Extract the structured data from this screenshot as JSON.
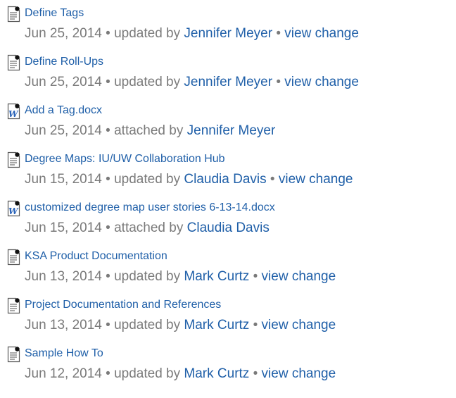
{
  "items": [
    {
      "type": "page",
      "icon": "page-icon",
      "title": "Define Tags",
      "date": "Jun 25, 2014",
      "action": "updated by",
      "user": "Jennifer Meyer",
      "change": "view change"
    },
    {
      "type": "page",
      "icon": "page-icon",
      "title": "Define Roll-Ups",
      "date": "Jun 25, 2014",
      "action": "updated by",
      "user": "Jennifer Meyer",
      "change": "view change"
    },
    {
      "type": "attachment",
      "icon": "word-doc-icon",
      "title": "Add a Tag.docx",
      "date": "Jun 25, 2014",
      "action": "attached by",
      "user": "Jennifer Meyer",
      "change": null
    },
    {
      "type": "page",
      "icon": "page-icon",
      "title": "Degree Maps: IU/UW Collaboration Hub",
      "date": "Jun 15, 2014",
      "action": "updated by",
      "user": "Claudia Davis",
      "change": "view change"
    },
    {
      "type": "attachment",
      "icon": "word-doc-icon",
      "title": "customized degree map user stories 6-13-14.docx",
      "date": "Jun 15, 2014",
      "action": "attached by",
      "user": "Claudia Davis",
      "change": null
    },
    {
      "type": "page",
      "icon": "page-icon",
      "title": "KSA Product Documentation",
      "date": "Jun 13, 2014",
      "action": "updated by",
      "user": "Mark Curtz",
      "change": "view change"
    },
    {
      "type": "page",
      "icon": "page-icon",
      "title": "Project Documentation and References",
      "date": "Jun 13, 2014",
      "action": "updated by",
      "user": "Mark Curtz",
      "change": "view change"
    },
    {
      "type": "page",
      "icon": "page-icon",
      "title": "Sample How To",
      "date": "Jun 12, 2014",
      "action": "updated by",
      "user": "Mark Curtz",
      "change": "view change"
    }
  ],
  "separator": "•",
  "colors": {
    "link": "#1f5fa8",
    "meta": "#7a7a7a"
  }
}
